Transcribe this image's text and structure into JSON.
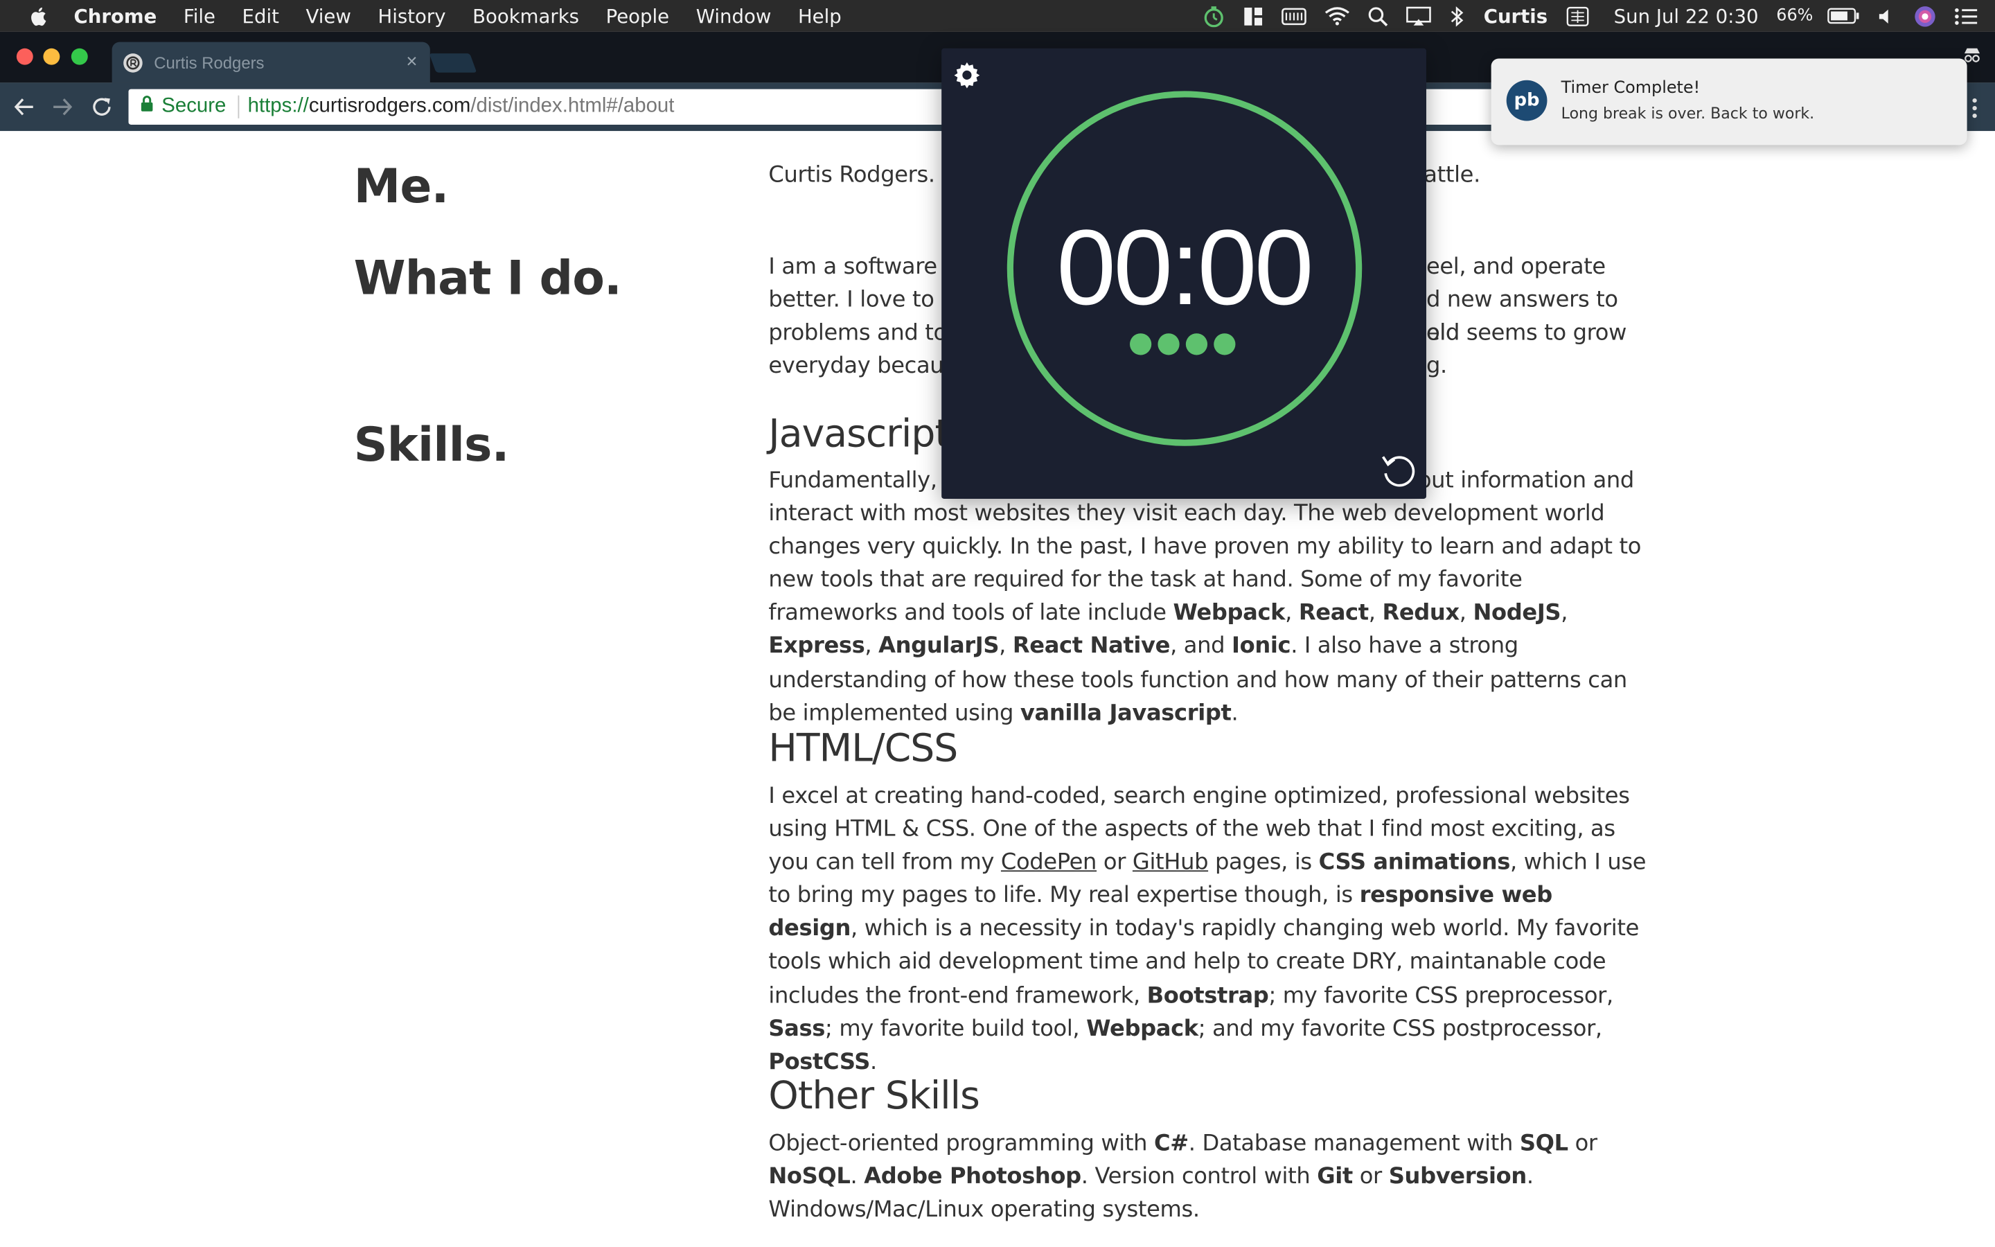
{
  "menubar": {
    "app": "Chrome",
    "items": [
      "File",
      "Edit",
      "View",
      "History",
      "Bookmarks",
      "People",
      "Window",
      "Help"
    ],
    "user": "Curtis",
    "datetime": "Sun Jul 22  0:30",
    "battery": "66%"
  },
  "tab": {
    "title": "Curtis Rodgers",
    "close": "×"
  },
  "omnibox": {
    "secure": "Secure",
    "scheme": "https://",
    "host": "curtisrodgers.com",
    "path": "/dist/index.html#/about"
  },
  "page": {
    "me_title": "Me.",
    "me_text": "Curtis Rodgers. V",
    "me_text_end": "attle.",
    "whatido_title": "What I do.",
    "whatido_lines": [
      [
        "I am a software e",
        "eel, and operate"
      ],
      [
        "better. I love to p",
        "d new answers to old"
      ],
      [
        "problems and to",
        "eld seems to grow"
      ],
      [
        "everyday becaus",
        "g."
      ]
    ],
    "skills_title": "Skills.",
    "js_title": "Javascript",
    "js_line1_start": "Fundamentally, J",
    "js_line1_end": "put information and",
    "js_rest": {
      "t1": "interact with most websites they visit each day. The web development world changes very quickly. In the past, I have proven my ability to learn and adapt to new tools that are required for the task at hand. Some of my favorite frameworks and tools of late include ",
      "b1": "Webpack",
      "c1": ", ",
      "b2": "React",
      "c2": ", ",
      "b3": "Redux",
      "c3": ", ",
      "b4": "NodeJS",
      "c4": ", ",
      "b5": "Express",
      "c5": ", ",
      "b6": "AngularJS",
      "c6": ", ",
      "b7": "React Native",
      "c7": ", and ",
      "b8": "Ionic",
      "t2": ". I also have a strong understanding of how these tools function and how many of their patterns can be implemented using ",
      "b9": "vanilla Javascript",
      "t3": "."
    },
    "html_title": "HTML/CSS",
    "html_text": {
      "t1": "I excel at creating hand-coded, search engine optimized, professional websites using HTML & CSS. One of the aspects of the web that I find most exciting, as you can tell from my ",
      "link1": "CodePen",
      "t2": " or ",
      "link2": "GitHub",
      "t3": " pages, is ",
      "b1": "CSS animations",
      "t4": ", which I use to bring my pages to life. My real expertise though, is ",
      "b2": "responsive web design",
      "t5": ", which is a necessity in today's rapidly changing web world. My favorite tools which aid development time and help to create DRY, maintanable code includes the front-end framework, ",
      "b3": "Bootstrap",
      "t6": "; my favorite CSS preprocessor, ",
      "b4": "Sass",
      "t7": "; my favorite build tool, ",
      "b5": "Webpack",
      "t8": "; and my favorite CSS postprocessor, ",
      "b6": "PostCSS",
      "t9": "."
    },
    "other_title": "Other Skills",
    "other_text": {
      "t1": "Object-oriented programming with ",
      "b1": "C#",
      "t2": ". Database management with ",
      "b2": "SQL",
      "t3": " or ",
      "b3": "NoSQL",
      "t4": ". ",
      "b4": "Adobe Photoshop",
      "t5": ". Version control with ",
      "b5": "Git",
      "t6": " or ",
      "b6": "Subversion",
      "t7": ". Windows/Mac/Linux operating systems."
    }
  },
  "timer": {
    "time": "00:00",
    "session_dots": 4,
    "ring_color": "#5ec16e",
    "background": "#1b2030"
  },
  "notification": {
    "app_badge": "pb",
    "title": "Timer Complete!",
    "body": "Long break is over. Back to work."
  },
  "icons": {
    "menubar": [
      "apple-icon",
      "timer-icon",
      "window-layout-icon",
      "keyboard-icon",
      "wifi-icon",
      "search-icon",
      "airplay-icon",
      "bluetooth-icon",
      "input-source-icon",
      "battery-icon",
      "volume-icon",
      "siri-icon",
      "notification-center-icon"
    ],
    "toolbar": [
      "back-icon",
      "forward-icon",
      "reload-icon",
      "lock-icon",
      "chrome-menu-icon"
    ]
  }
}
